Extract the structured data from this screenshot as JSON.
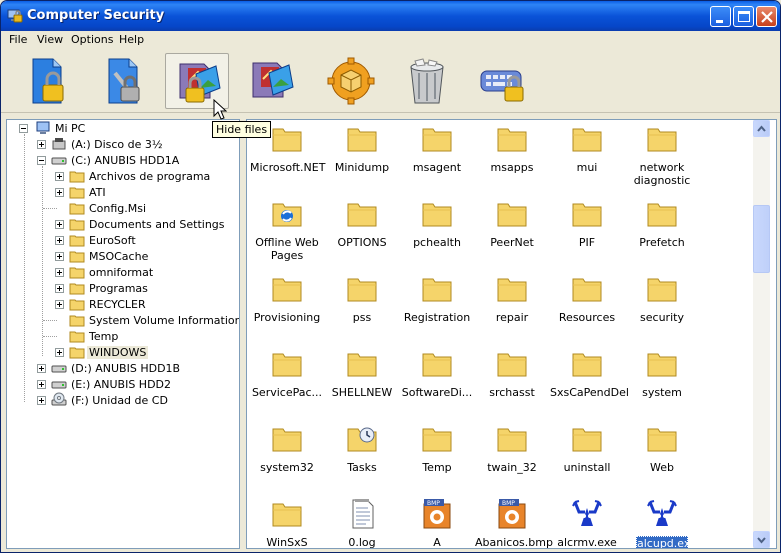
{
  "window": {
    "title": "Computer Security",
    "minimize_icon": "minimize-icon",
    "maximize_icon": "maximize-icon",
    "close_icon": "close-icon"
  },
  "menu": [
    "File",
    "View",
    "Options",
    "Help"
  ],
  "toolbar": {
    "buttons": [
      {
        "icon": "lock-file-icon"
      },
      {
        "icon": "lock-tools-icon"
      },
      {
        "icon": "hide-files-icon",
        "pressed": true
      },
      {
        "icon": "folder-pictures-icon"
      },
      {
        "icon": "package-gear-icon"
      },
      {
        "icon": "recycle-bin-icon"
      },
      {
        "icon": "lock-keyboard-icon"
      }
    ],
    "tooltip": "Hide files"
  },
  "tree": {
    "root": "Mi PC",
    "drives": {
      "a": "(A:)  Disco de 3½",
      "c": "(C:)  ANUBIS HDD1A",
      "d": "(D:)  ANUBIS HDD1B",
      "e": "(E:)  ANUBIS HDD2",
      "f": "(F:)  Unidad de CD"
    },
    "c_children": [
      "Archivos de programa",
      "ATI",
      "Config.Msi",
      "Documents and Settings",
      "EuroSoft",
      "MSOCache",
      "omniformat",
      "Programas",
      "RECYCLER",
      "System Volume Information",
      "Temp",
      "WINDOWS"
    ],
    "selected": "WINDOWS"
  },
  "files": [
    "Microsoft.NET",
    "Minidump",
    "msagent",
    "msapps",
    "mui",
    "network diagnostic",
    "Offline Web Pages",
    "OPTIONS",
    "pchealth",
    "PeerNet",
    "PIF",
    "Prefetch",
    "Provisioning",
    "pss",
    "Registration",
    "repair",
    "Resources",
    "security",
    "ServicePac...",
    "SHELLNEW",
    "SoftwareDi...",
    "srchasst",
    "SxsCaPendDel",
    "system",
    "system32",
    "Tasks",
    "Temp",
    "twain_32",
    "uninstall",
    "Web",
    "WinSxS",
    "0.log",
    "A pescar.bmp",
    "Abanicos.bmp",
    "alcrmv.exe",
    "alcupd.exe"
  ],
  "selected_file": "alcupd.exe",
  "colors": {
    "titlebar": "#0a53d8",
    "folder": "#f5d46a",
    "selection": "#316ac5"
  }
}
